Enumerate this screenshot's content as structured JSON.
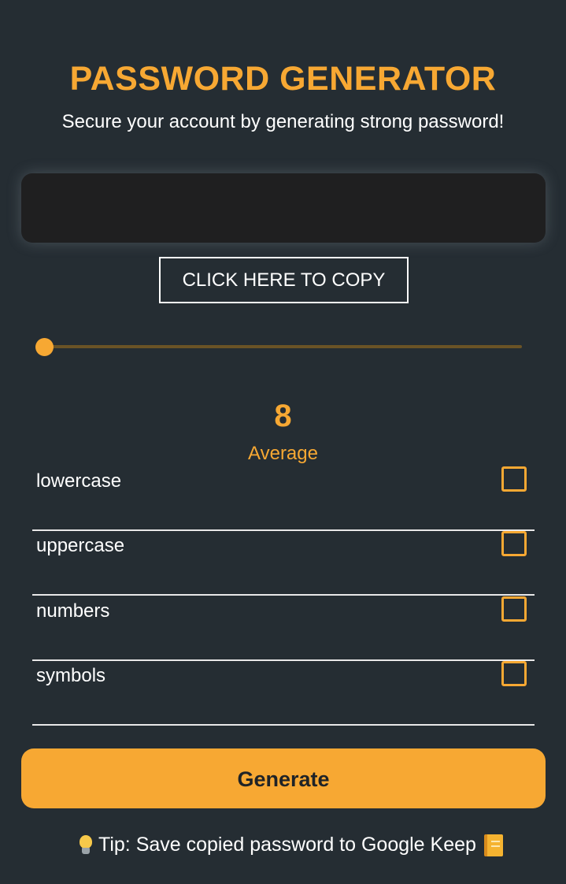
{
  "header": {
    "title": "PASSWORD GENERATOR",
    "subtitle": "Secure your account by generating strong password!"
  },
  "password_output": {
    "value": ""
  },
  "copy_button": {
    "label": "CLICK HERE TO COPY"
  },
  "length": {
    "value": "8",
    "strength": "Average",
    "slider_fraction": 0
  },
  "options": [
    {
      "label": "lowercase",
      "checked": false
    },
    {
      "label": "uppercase",
      "checked": false
    },
    {
      "label": "numbers",
      "checked": false
    },
    {
      "label": "symbols",
      "checked": false
    }
  ],
  "generate_button": {
    "label": "Generate"
  },
  "tip": {
    "text": "Tip: Save copied password to Google Keep",
    "leading_icon": "lightbulb-icon",
    "trailing_icon": "notebook-icon"
  },
  "colors": {
    "background": "#252d33",
    "accent": "#f7a833",
    "output_background": "#1f1f20"
  }
}
